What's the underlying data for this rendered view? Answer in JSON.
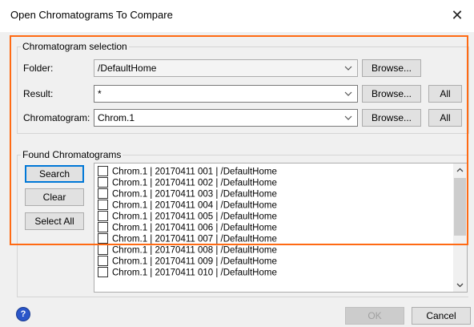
{
  "window": {
    "title": "Open Chromatograms To Compare",
    "close_glyph": "✕"
  },
  "selection": {
    "legend": "Chromatogram selection",
    "folder": {
      "label": "Folder:",
      "value": "/DefaultHome",
      "browse_label": "Browse..."
    },
    "result": {
      "label": "Result:",
      "value": "*",
      "browse_label": "Browse...",
      "all_label": "All"
    },
    "chromatogram": {
      "label": "Chromatogram:",
      "value": "Chrom.1",
      "browse_label": "Browse...",
      "all_label": "All"
    }
  },
  "found": {
    "legend": "Found Chromatograms",
    "search_label": "Search",
    "clear_label": "Clear",
    "select_all_label": "Select All",
    "items": [
      "Chrom.1 | 20170411 001 | /DefaultHome",
      "Chrom.1 | 20170411 002 | /DefaultHome",
      "Chrom.1 | 20170411 003 | /DefaultHome",
      "Chrom.1 | 20170411 004 | /DefaultHome",
      "Chrom.1 | 20170411 005 | /DefaultHome",
      "Chrom.1 | 20170411 006 | /DefaultHome",
      "Chrom.1 | 20170411 007 | /DefaultHome",
      "Chrom.1 | 20170411 008 | /DefaultHome",
      "Chrom.1 | 20170411 009 | /DefaultHome",
      "Chrom.1 | 20170411 010 | /DefaultHome"
    ]
  },
  "footer": {
    "help_glyph": "?",
    "ok_label": "OK",
    "cancel_label": "Cancel"
  },
  "colors": {
    "highlight": "#ff6a13",
    "primary_border": "#0078d7"
  }
}
